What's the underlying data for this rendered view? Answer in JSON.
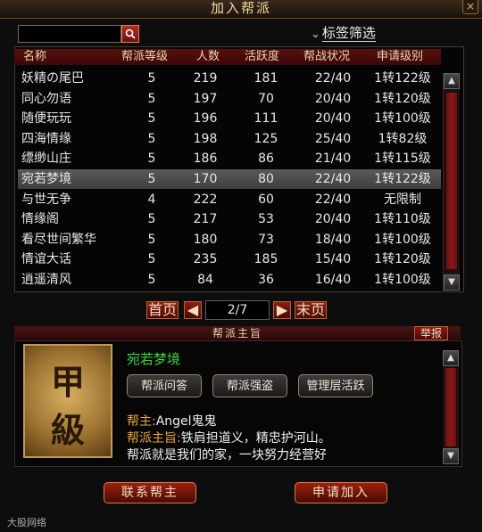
{
  "window": {
    "title": "加入帮派",
    "close_glyph": "×"
  },
  "search": {
    "value": "",
    "icon": "search-icon"
  },
  "filter": {
    "chevron": "⌄",
    "label": "标签筛选"
  },
  "table": {
    "headers": [
      "名称",
      "帮派等级",
      "人数",
      "活跃度",
      "帮战状况",
      "申请级别"
    ],
    "rows": [
      {
        "name": "妖精の尾巴",
        "level": "5",
        "count": "219",
        "activity": "181",
        "war": "22/40",
        "req": "1转122级"
      },
      {
        "name": "同心勿语",
        "level": "5",
        "count": "197",
        "activity": "70",
        "war": "20/40",
        "req": "1转120级"
      },
      {
        "name": "随便玩玩",
        "level": "5",
        "count": "196",
        "activity": "111",
        "war": "20/40",
        "req": "1转100级"
      },
      {
        "name": "四海情缘",
        "level": "5",
        "count": "198",
        "activity": "125",
        "war": "25/40",
        "req": "1转82级"
      },
      {
        "name": "缥缈山庄",
        "level": "5",
        "count": "186",
        "activity": "86",
        "war": "21/40",
        "req": "1转115级"
      },
      {
        "name": "宛若梦境",
        "level": "5",
        "count": "170",
        "activity": "80",
        "war": "22/40",
        "req": "1转122级"
      },
      {
        "name": "与世无争",
        "level": "4",
        "count": "222",
        "activity": "60",
        "war": "22/40",
        "req": "无限制"
      },
      {
        "name": "情缘阁",
        "level": "5",
        "count": "217",
        "activity": "53",
        "war": "20/40",
        "req": "1转110级"
      },
      {
        "name": "看尽世间繁华",
        "level": "5",
        "count": "180",
        "activity": "73",
        "war": "18/40",
        "req": "1转100级"
      },
      {
        "name": "情谊大话",
        "level": "5",
        "count": "235",
        "activity": "185",
        "war": "15/40",
        "req": "1转120级"
      },
      {
        "name": "逍遥清风",
        "level": "5",
        "count": "84",
        "activity": "36",
        "war": "16/40",
        "req": "1转100级"
      }
    ],
    "selected_index": 5
  },
  "pager": {
    "first": "首页",
    "prev": "◀",
    "page": "2/7",
    "next": "▶",
    "last": "末页"
  },
  "detail": {
    "section_title": "帮派主旨",
    "report": "举报",
    "emblem_top": "甲",
    "emblem_bottom": "級",
    "guild_name": "宛若梦境",
    "buttons": [
      "帮派问答",
      "帮派强盗",
      "管理层活跃"
    ],
    "leader_key": "帮主:",
    "leader_value": "Angel鬼鬼",
    "motto_key": "帮派主旨:",
    "motto_line1": "铁肩担道义，精忠护河山。",
    "motto_line2": "帮派就是我们的家，一块努力经营好"
  },
  "actions": {
    "contact": "联系帮主",
    "apply": "申请加入"
  },
  "watermark": "大股网络",
  "colors": {
    "accent_red": "#7a1010",
    "guild_name_green": "#38d838",
    "key_orange": "#e8a830"
  }
}
